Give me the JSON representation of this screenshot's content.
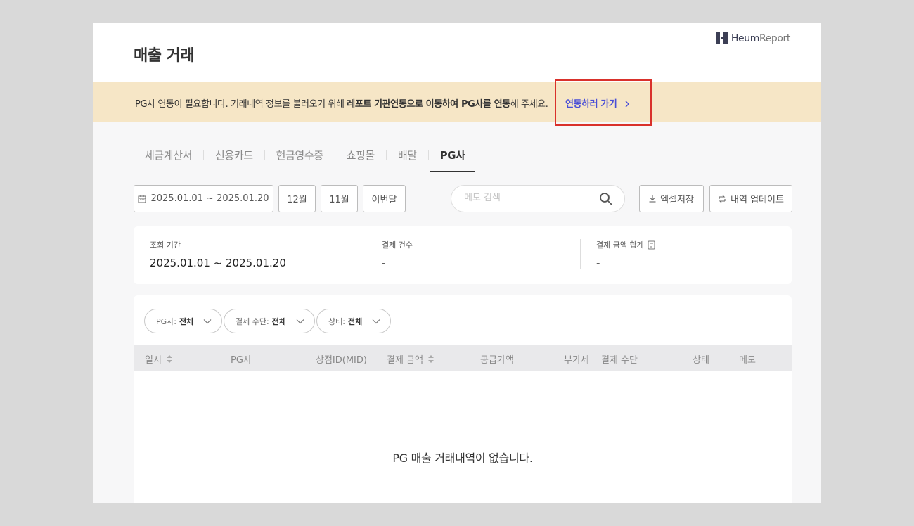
{
  "header": {
    "title": "매출 거래",
    "brand_heum": "Heum",
    "brand_report": "Report"
  },
  "notice": {
    "text_prefix": "PG사 연동이 필요합니다. 거래내역 정보를 불러오기 위해 ",
    "text_bold": "레포트 기관연동으로 이동하여 PG사를 연동",
    "text_suffix": "해 주세요.",
    "link_label": "연동하러 가기",
    "background": "#f6e6c6",
    "link_color": "#4a4fd6"
  },
  "tabs": [
    {
      "label": "세금계산서",
      "active": false
    },
    {
      "label": "신용카드",
      "active": false
    },
    {
      "label": "현금영수증",
      "active": false
    },
    {
      "label": "쇼핑몰",
      "active": false
    },
    {
      "label": "배달",
      "active": false
    },
    {
      "label": "PG사",
      "active": true
    }
  ],
  "toolbar": {
    "date_range": "2025.01.01 ~ 2025.01.20",
    "btn_dec": "12월",
    "btn_nov": "11월",
    "btn_this_month": "이번달",
    "search_placeholder": "메모 검색",
    "excel_label": "엑셀저장",
    "update_label": "내역 업데이트"
  },
  "summary": {
    "period_label": "조회 기간",
    "period_value": "2025.01.01 ~ 2025.01.20",
    "count_label": "결제 건수",
    "count_value": "-",
    "amount_label": "결제 금액 합계",
    "amount_value": "-"
  },
  "filters": [
    {
      "prefix": "PG사: ",
      "value": "전체"
    },
    {
      "prefix": "결제 수단: ",
      "value": "전체"
    },
    {
      "prefix": "상태: ",
      "value": "전체"
    }
  ],
  "table": {
    "columns": [
      "일시",
      "PG사",
      "상점ID(MID)",
      "결제 금액",
      "공급가액",
      "부가세",
      "결제 수단",
      "상태",
      "메모"
    ],
    "empty_message": "PG 매출 거래내역이 없습니다."
  }
}
